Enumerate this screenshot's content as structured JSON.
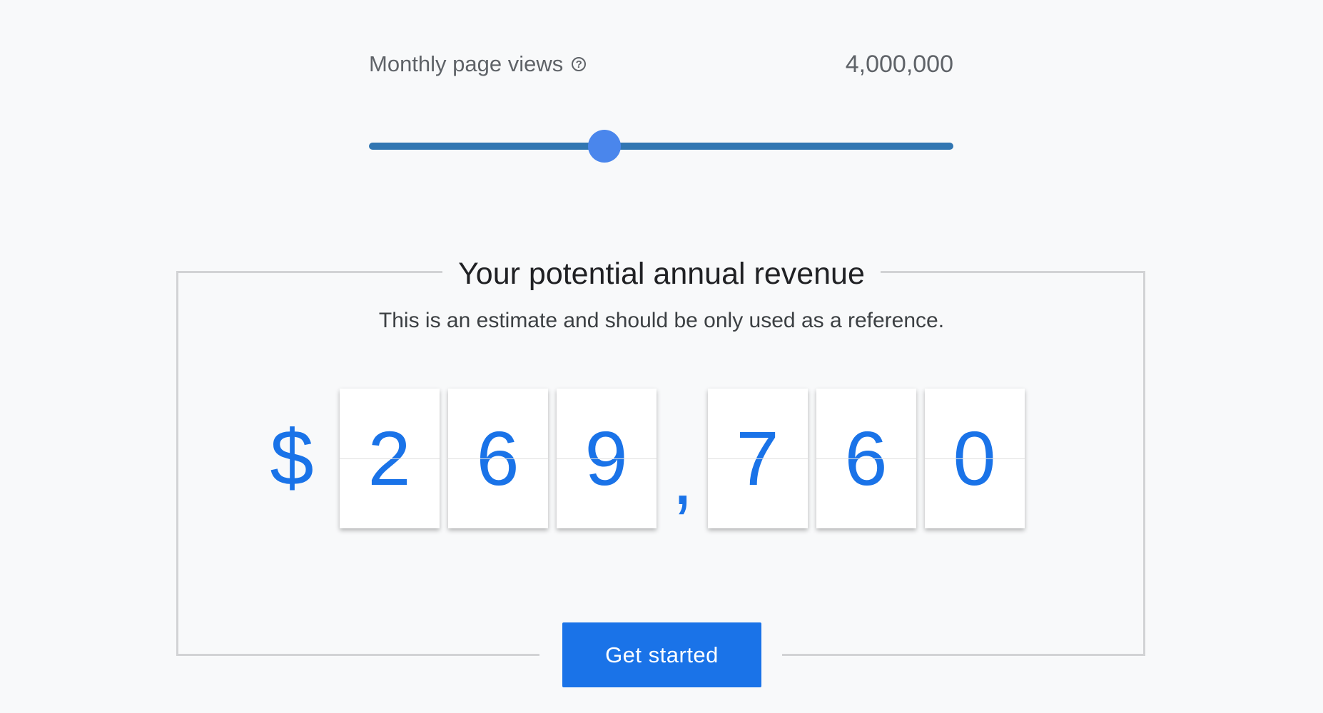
{
  "slider": {
    "label": "Monthly page views",
    "help_icon": "question-circle-icon",
    "help_glyph": "?",
    "value_text": "4,000,000",
    "position_fraction": 0.403,
    "track_color": "#3176b2",
    "thumb_color": "#4a86ec"
  },
  "revenue": {
    "title": "Your potential annual revenue",
    "subtitle": "This is an estimate and should be only used as a reference.",
    "currency_symbol": "$",
    "digits": [
      "2",
      "6",
      "9",
      "7",
      "6",
      "0"
    ],
    "separator": ",",
    "digit_color": "#1a73e8"
  },
  "cta": {
    "label": "Get started",
    "color": "#1a73e8"
  }
}
